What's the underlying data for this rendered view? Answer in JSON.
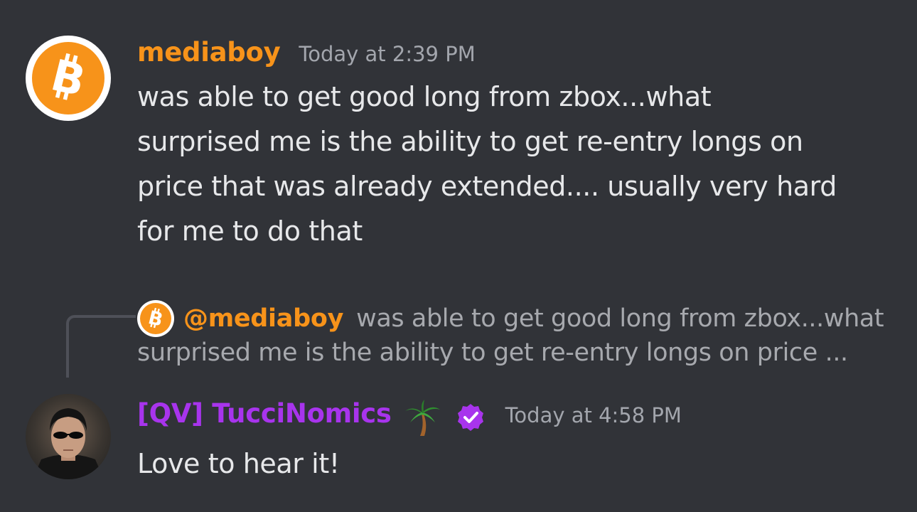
{
  "colors": {
    "background": "#313338",
    "mediaboy_name": "#f7931a",
    "tucci_name": "#a834ed",
    "message_text": "#e7e8ea",
    "timestamp": "#a3a6ad",
    "verified_badge": "#a834ed"
  },
  "messages": [
    {
      "avatar_icon": "bitcoin-logo-icon",
      "username": "mediaboy",
      "timestamp": "Today at 2:39 PM",
      "lines": [
        "was able to get good long from zbox...what",
        "surprised me is the ability to get re-entry longs on",
        "price that was already extended.... usually very hard",
        "for me to do that"
      ]
    },
    {
      "reply": {
        "avatar_icon": "bitcoin-logo-icon",
        "mention": "@mediaboy",
        "line1": "was able to get good long from zbox...what",
        "line2": "surprised me is the ability to get re-entry longs on price ..."
      },
      "avatar_icon": "user-photo-avatar",
      "username": "[QV] TucciNomics",
      "name_emoji": "palm-tree-icon",
      "badge_icon": "verified-check-icon",
      "timestamp": "Today at 4:58 PM",
      "text": "Love to hear it!"
    }
  ]
}
